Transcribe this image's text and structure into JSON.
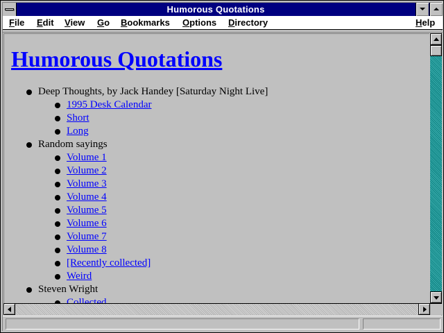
{
  "window": {
    "title": "Humorous Quotations"
  },
  "menubar": {
    "items": [
      {
        "label": "File",
        "accel": "F",
        "rest": "ile"
      },
      {
        "label": "Edit",
        "accel": "E",
        "rest": "dit"
      },
      {
        "label": "View",
        "accel": "V",
        "rest": "iew"
      },
      {
        "label": "Go",
        "accel": "G",
        "rest": "o"
      },
      {
        "label": "Bookmarks",
        "accel": "B",
        "rest": "ookmarks"
      },
      {
        "label": "Options",
        "accel": "O",
        "rest": "ptions"
      },
      {
        "label": "Directory",
        "accel": "D",
        "rest": "irectory"
      },
      {
        "label": "Help",
        "accel": "H",
        "rest": "elp"
      }
    ]
  },
  "page": {
    "heading": "Humorous Quotations",
    "sections": [
      {
        "label": "Deep Thoughts, by Jack Handey [Saturday Night Live]",
        "links": [
          "1995 Desk Calendar",
          "Short",
          "Long"
        ]
      },
      {
        "label": "Random sayings",
        "links": [
          "Volume 1",
          "Volume 2",
          "Volume 3",
          "Volume 4",
          "Volume 5",
          "Volume 6",
          "Volume 7",
          "Volume 8",
          "[Recently collected]",
          "Weird"
        ]
      },
      {
        "label": "Steven Wright",
        "links": [
          "Collected"
        ]
      }
    ]
  },
  "status": {
    "text": ""
  },
  "colors": {
    "titlebar": "#000080",
    "link": "#0000ff",
    "background": "#c0c0c0",
    "scroll_track": "#0f8f8f"
  },
  "icons": {
    "system_menu": "system-menu-icon",
    "minimize": "minimize-icon",
    "maximize": "maximize-icon",
    "scroll_up": "arrow-up-icon",
    "scroll_down": "arrow-down-icon",
    "scroll_left": "arrow-left-icon",
    "scroll_right": "arrow-right-icon"
  }
}
